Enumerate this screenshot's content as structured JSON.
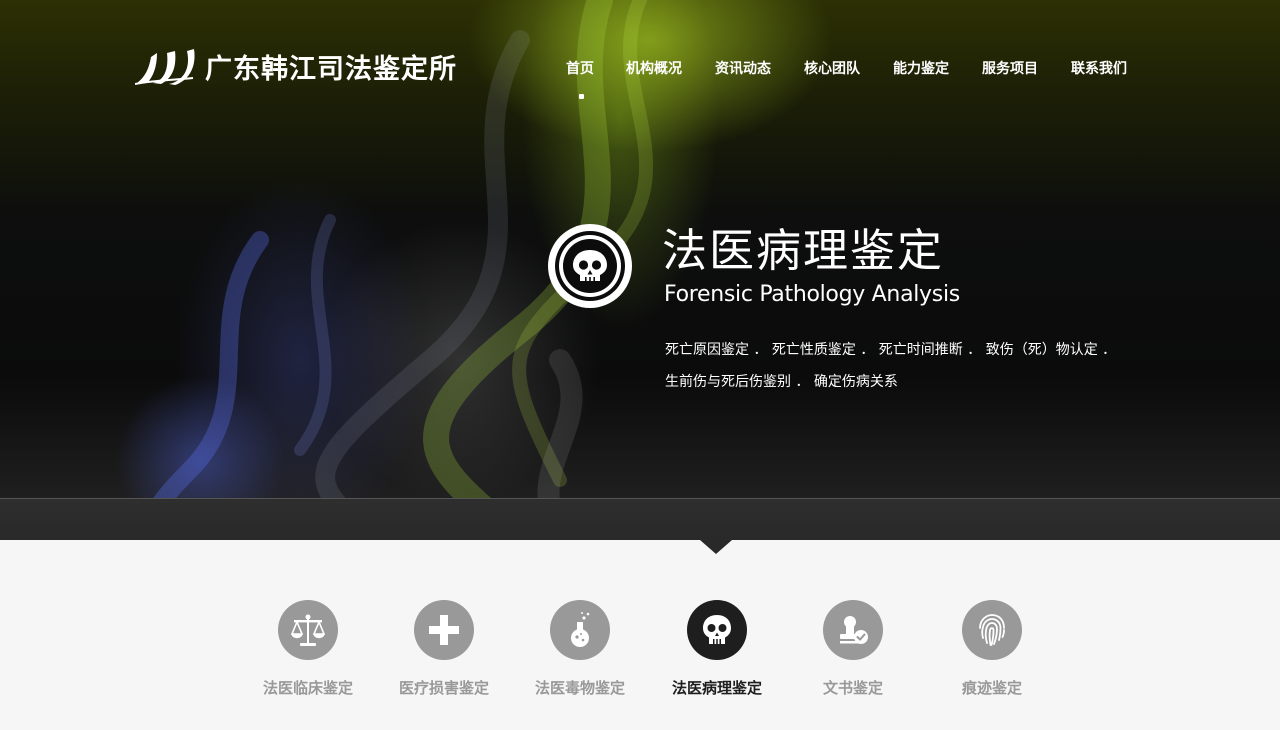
{
  "brand": {
    "name": "广东韩江司法鉴定所",
    "logo": "hj-swoosh-logo"
  },
  "nav": {
    "items": [
      {
        "label": "首页",
        "active": true
      },
      {
        "label": "机构概况"
      },
      {
        "label": "资讯动态"
      },
      {
        "label": "核心团队"
      },
      {
        "label": "能力鉴定"
      },
      {
        "label": "服务项目"
      },
      {
        "label": "联系我们"
      }
    ]
  },
  "feature": {
    "icon": "skull-icon",
    "title": "法医病理鉴定",
    "subtitle": "Forensic Pathology Analysis",
    "desc_line1": "死亡原因鉴定 ． 死亡性质鉴定 ． 死亡时间推断 ． 致伤（死）物认定 ．",
    "desc_line2": "生前伤与死后伤鉴别 ． 确定伤病关系"
  },
  "services": [
    {
      "label": "法医临床鉴定",
      "icon": "scales-icon"
    },
    {
      "label": "医疗损害鉴定",
      "icon": "medical-cross-icon"
    },
    {
      "label": "法医毒物鉴定",
      "icon": "flask-icon"
    },
    {
      "label": "法医病理鉴定",
      "icon": "skull-icon",
      "active": true
    },
    {
      "label": "文书鉴定",
      "icon": "document-seal-icon"
    },
    {
      "label": "痕迹鉴定",
      "icon": "fingerprint-icon"
    }
  ],
  "colors": {
    "accent_active": "#1e1e1e",
    "icon_inactive": "#999999",
    "page_background": "#f6f6f6"
  }
}
